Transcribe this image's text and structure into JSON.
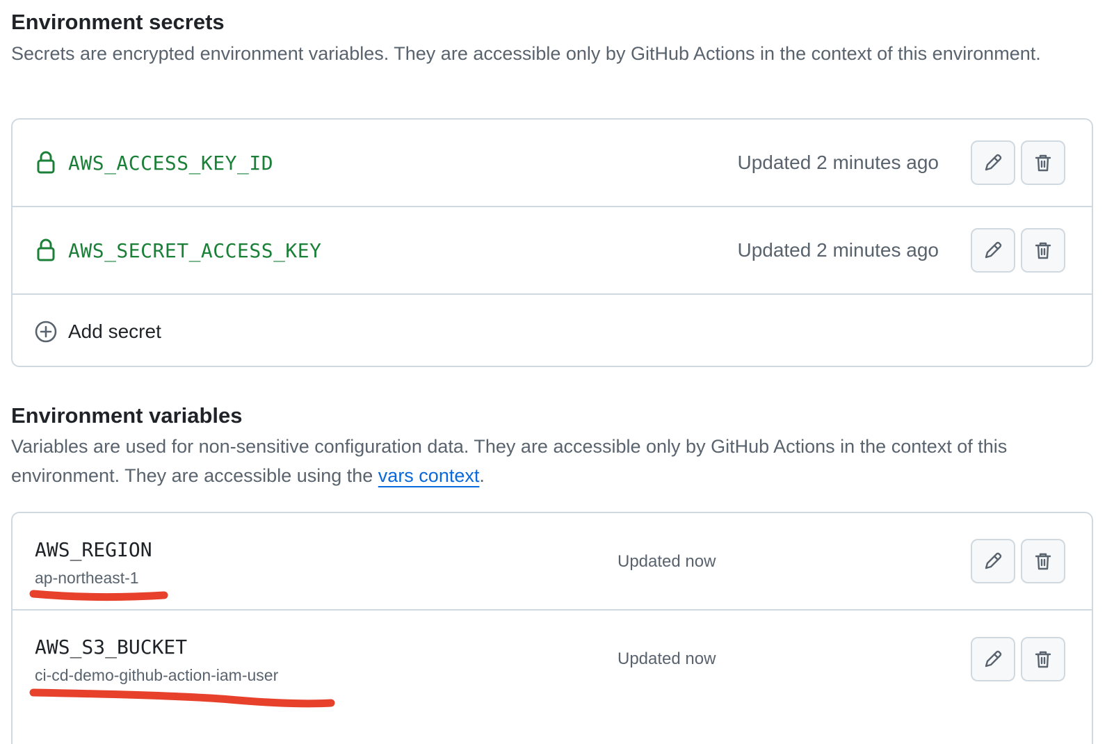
{
  "secrets_section": {
    "title": "Environment secrets",
    "description": "Secrets are encrypted environment variables. They are accessible only by GitHub Actions in the context of this environment.",
    "items": [
      {
        "name": "AWS_ACCESS_KEY_ID",
        "updated": "Updated 2 minutes ago"
      },
      {
        "name": "AWS_SECRET_ACCESS_KEY",
        "updated": "Updated 2 minutes ago"
      }
    ],
    "add_label": "Add secret"
  },
  "variables_section": {
    "title": "Environment variables",
    "description_before_link": "Variables are used for non-sensitive configuration data. They are accessible only by GitHub Actions in the context of this environment. They are accessible using the ",
    "link_text": "vars context",
    "description_after_link": ".",
    "items": [
      {
        "name": "AWS_REGION",
        "value": "ap-northeast-1",
        "updated": "Updated now"
      },
      {
        "name": "AWS_S3_BUCKET",
        "value": "ci-cd-demo-github-action-iam-user",
        "updated": "Updated now"
      }
    ]
  },
  "icons": {
    "lock": "lock-icon",
    "edit": "pencil-icon",
    "delete": "trash-icon",
    "add": "plus-circle-icon"
  },
  "colors": {
    "secret_name": "#1a7f37",
    "link": "#0969da",
    "annotation": "#e8412b",
    "border": "#d1d9e0"
  }
}
